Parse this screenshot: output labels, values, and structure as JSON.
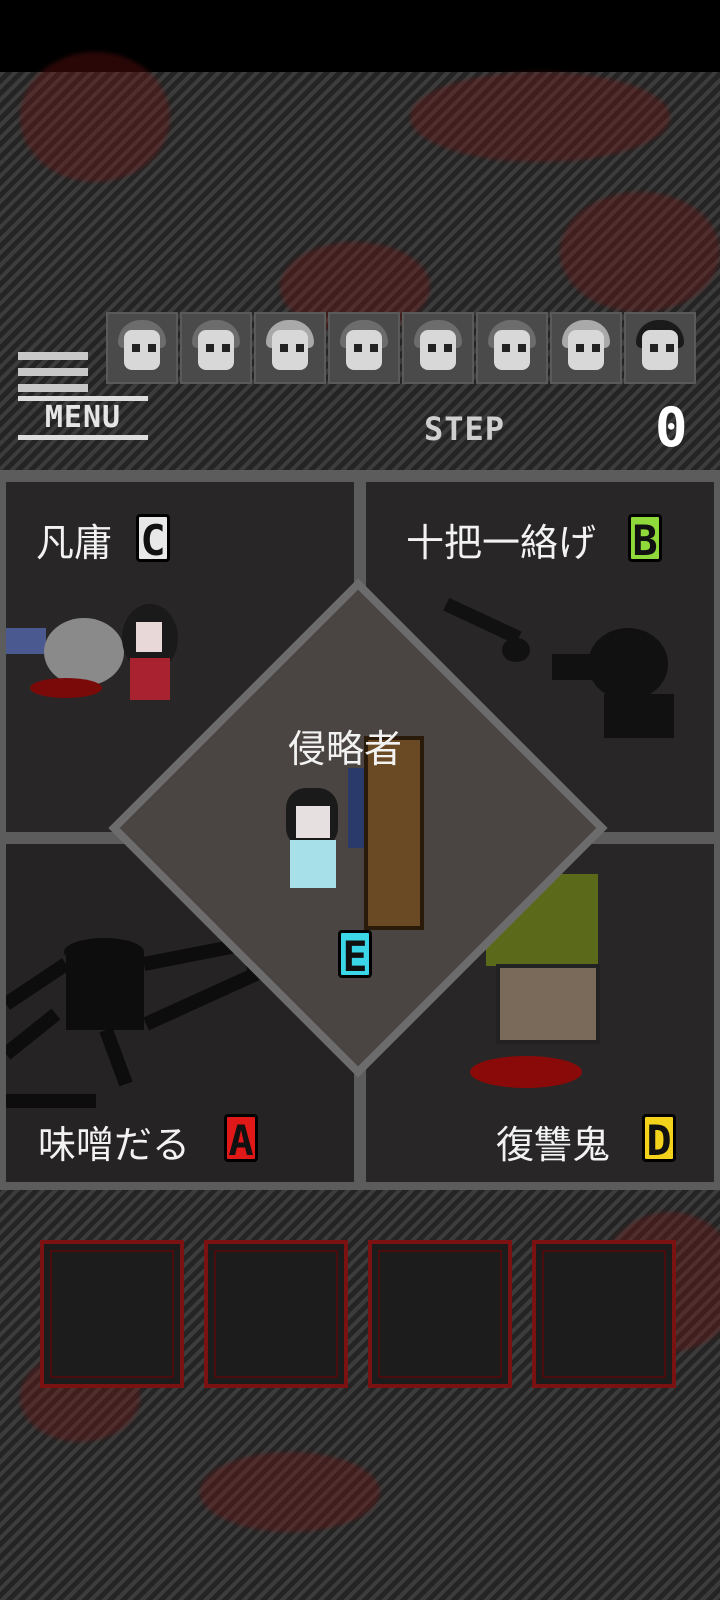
{
  "menu": {
    "label": "MENU"
  },
  "step": {
    "label": "STEP",
    "value": "0"
  },
  "characters": [
    {
      "icon": "girl-portrait-icon"
    },
    {
      "icon": "girl-portrait-icon"
    },
    {
      "icon": "girl-portrait-icon"
    },
    {
      "icon": "girl-portrait-icon"
    },
    {
      "icon": "girl-portrait-icon"
    },
    {
      "icon": "girl-portrait-icon"
    },
    {
      "icon": "girl-portrait-icon"
    },
    {
      "icon": "girl-portrait-icon"
    }
  ],
  "endings": {
    "top_left": {
      "label": "凡庸",
      "grade": "C",
      "grade_color": "#e8e8e8"
    },
    "top_right": {
      "label": "十把一絡げ",
      "grade": "B",
      "grade_color": "#8fd93a"
    },
    "bottom_left": {
      "label": "味噌だる",
      "grade": "A",
      "grade_color": "#e01818"
    },
    "bottom_right": {
      "label": "復讐鬼",
      "grade": "D",
      "grade_color": "#f2d21a"
    },
    "center": {
      "label": "侵略者",
      "grade": "E",
      "grade_color": "#3bd6e8"
    }
  },
  "inventory": {
    "slots": 4
  }
}
